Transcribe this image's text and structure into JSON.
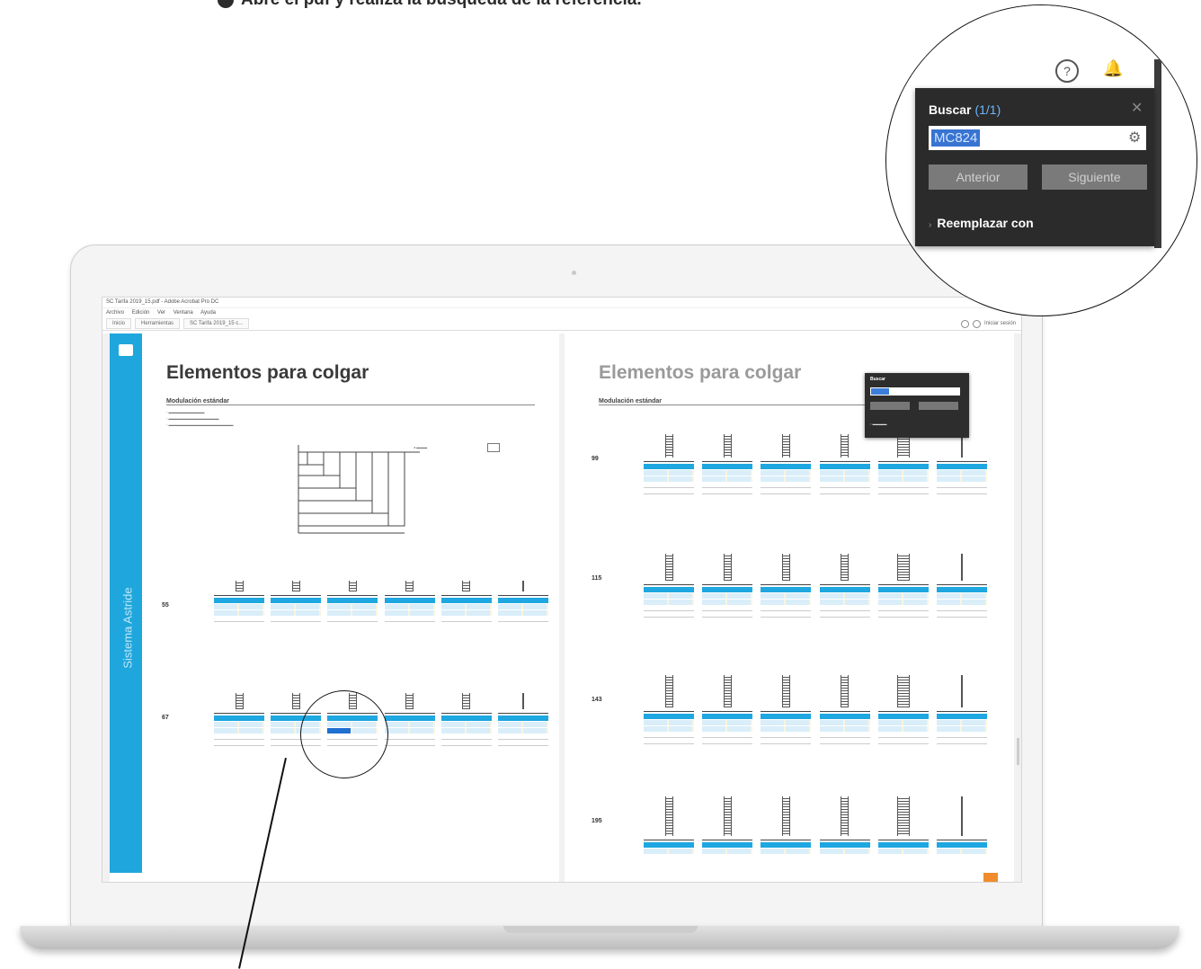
{
  "caption": {
    "step": "",
    "text": "Abre el pdf y realiza la búsqueda de la referencia."
  },
  "app": {
    "window_title": "SC Tarifa 2019_15.pdf - Adobe Acrobat Pro DC",
    "menu": [
      "Archivo",
      "Edición",
      "Ver",
      "Ventana",
      "Ayuda"
    ],
    "tabs": [
      "Inicio",
      "Herramientas",
      "SC Tarifa 2019_15 c..."
    ],
    "share": "Iniciar sesión"
  },
  "document": {
    "sidebar_text": "Sistema Astride",
    "left_page": {
      "title": "Elementos para colgar",
      "subtitle": "Modulación estándar",
      "heights": [
        "55",
        "67"
      ]
    },
    "right_page": {
      "title": "Elementos para colgar",
      "subtitle": "Modulación estándar",
      "heights": [
        "99",
        "115",
        "143",
        "195"
      ]
    }
  },
  "find_panel": {
    "title": "Buscar",
    "count": "(1/1)",
    "query": "MC824",
    "prev_label": "Anterior",
    "next_label": "Siguiente",
    "replace_label": "Reemplazar con",
    "close_icon": "close-icon",
    "options_icon": "gear-icon"
  },
  "toolbar_icons": [
    "help-icon",
    "bell-icon"
  ]
}
